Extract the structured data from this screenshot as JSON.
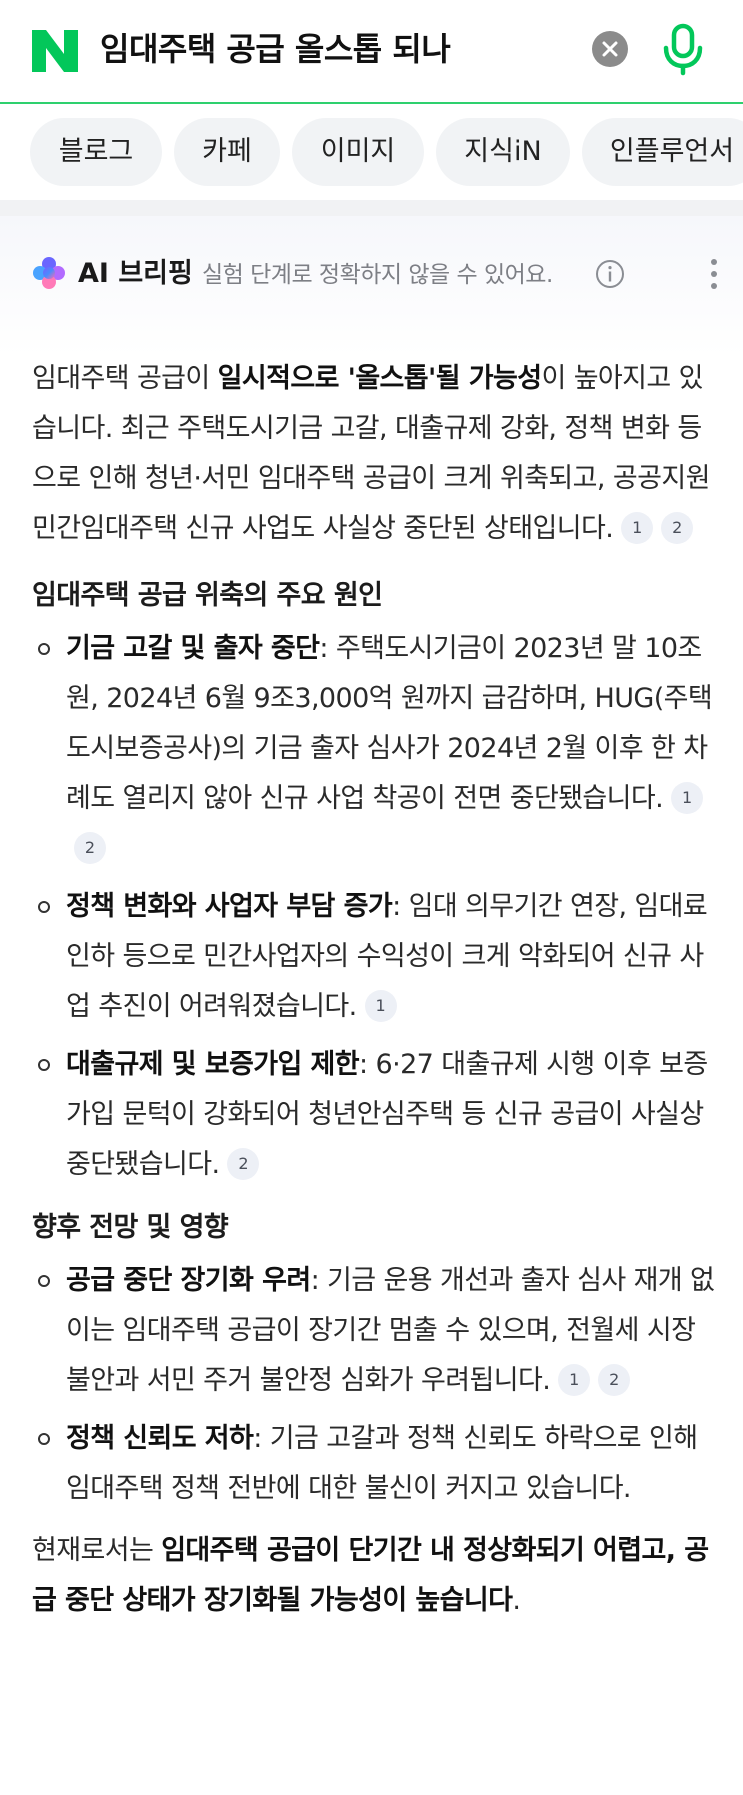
{
  "search": {
    "query": "임대주택 공급 올스톱 되나"
  },
  "tabs": [
    {
      "label": "블로그"
    },
    {
      "label": "카페"
    },
    {
      "label": "이미지"
    },
    {
      "label": "지식iN"
    },
    {
      "label": "인플루언서"
    }
  ],
  "ai": {
    "title": "AI 브리핑",
    "subtitle": "실험 단계로 정확하지 않을 수 있어요.",
    "intro": {
      "pre": "임대주택 공급이 ",
      "bold": "일시적으로 '올스톱'될 가능성",
      "post": "이 높아지고 있습니다. 최근 주택도시기금 고갈, 대출규제 강화, 정책 변화 등으로 인해 청년·서민 임대주택 공급이 크게 위축되고, 공공지원 민간임대주택 신규 사업도 사실상 중단된 상태입니다.",
      "cites": [
        "1",
        "2"
      ]
    },
    "section1": {
      "heading": "임대주택 공급 위축의 주요 원인",
      "items": [
        {
          "bold": "기금 고갈 및 출자 중단",
          "text": ": 주택도시기금이 2023년 말 10조 원, 2024년 6월 9조3,000억 원까지 급감하며, HUG(주택도시보증공사)의 기금 출자 심사가 2024년 2월 이후 한 차례도 열리지 않아 신규 사업 착공이 전면 중단됐습니다.",
          "cites": [
            "1",
            "2"
          ]
        },
        {
          "bold": "정책 변화와 사업자 부담 증가",
          "text": ": 임대 의무기간 연장, 임대료 인하 등으로 민간사업자의 수익성이 크게 악화되어 신규 사업 추진이 어려워졌습니다.",
          "cites": [
            "1"
          ]
        },
        {
          "bold": "대출규제 및 보증가입 제한",
          "text": ": 6·27 대출규제 시행 이후 보증가입 문턱이 강화되어 청년안심주택 등 신규 공급이 사실상 중단됐습니다.",
          "cites": [
            "2"
          ]
        }
      ]
    },
    "section2": {
      "heading": "향후 전망 및 영향",
      "items": [
        {
          "bold": "공급 중단 장기화 우려",
          "text": ": 기금 운용 개선과 출자 심사 재개 없이는 임대주택 공급이 장기간 멈출 수 있으며, 전월세 시장 불안과 서민 주거 불안정 심화가 우려됩니다.",
          "cites": [
            "1",
            "2"
          ]
        },
        {
          "bold": "정책 신뢰도 저하",
          "text": ": 기금 고갈과 정책 신뢰도 하락으로 인해 임대주택 정책 전반에 대한 불신이 커지고 있습니다.",
          "cites": []
        }
      ]
    },
    "conclusion": {
      "pre": "현재로서는 ",
      "bold": "임대주택 공급이 단기간 내 정상화되기 어렵고, 공급 중단 상태가 장기화될 가능성이 높습니다",
      "post": "."
    }
  },
  "colors": {
    "brand_green": "#03c75a",
    "divider_green": "#2ed06e",
    "chip_bg": "#f1f3f5",
    "cite_bg": "#edf0f6"
  },
  "icons": [
    "naver-logo",
    "clear-icon",
    "mic-icon",
    "ai-sparkle-icon",
    "info-icon",
    "more-vertical-icon"
  ]
}
